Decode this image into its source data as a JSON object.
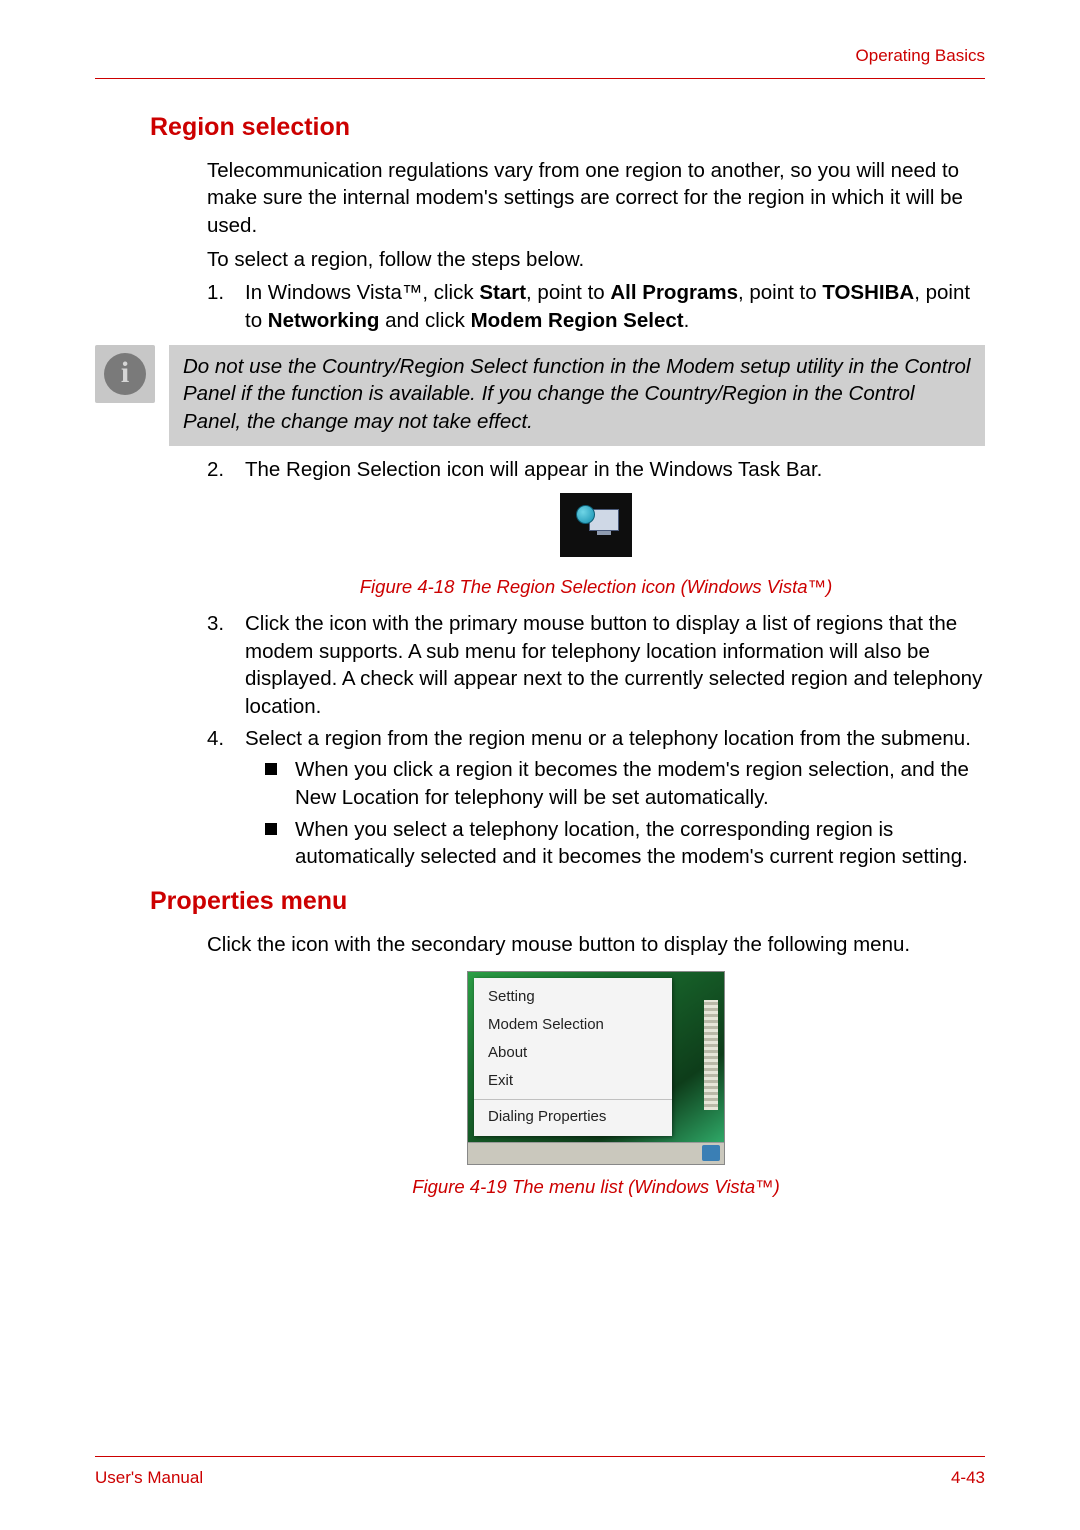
{
  "header": {
    "section_link": "Operating Basics"
  },
  "region_selection": {
    "heading": "Region selection",
    "intro": "Telecommunication regulations vary from one region to another, so you will need to make sure the internal modem's settings are correct for the region in which it will be used.",
    "pre_steps": "To select a region, follow the steps below.",
    "step1": {
      "pre": "In Windows Vista™, click ",
      "b1": "Start",
      "m1": ", point to ",
      "b2": "All Programs",
      "m2": ", point to ",
      "b3": "TOSHIBA",
      "m3": ", point to ",
      "b4": "Networking",
      "m4": " and click ",
      "b5": "Modem Region Select",
      "post": "."
    },
    "note": "Do not use the Country/Region Select function in the Modem setup utility in the Control Panel if the function is available. If you change the Country/Region in the Control Panel, the change may not take effect.",
    "step2": "The Region Selection icon will appear in the Windows Task Bar.",
    "fig1_caption": "Figure 4-18 The Region Selection icon (Windows Vista™)",
    "step3": "Click the icon with the primary mouse button to display a list of regions that the modem supports. A sub menu for telephony location information will also be displayed. A check will appear next to the currently selected region and telephony location.",
    "step4": "Select a region from the region menu or a telephony location from the submenu.",
    "bullets": [
      "When you click a region it becomes the modem's region selection, and the New Location for telephony will be set automatically.",
      "When you select a telephony location, the corresponding region is automatically selected and it becomes the modem's current region setting."
    ]
  },
  "properties_menu": {
    "heading": "Properties menu",
    "intro": "Click the icon with the secondary mouse button to display the following menu.",
    "menu": {
      "items_top": [
        "Setting",
        "Modem Selection",
        "About",
        "Exit"
      ],
      "items_bottom": [
        "Dialing Properties"
      ]
    },
    "fig2_caption": "Figure 4-19 The menu list (Windows Vista™)"
  },
  "footer": {
    "left": "User's Manual",
    "right": "4-43"
  }
}
